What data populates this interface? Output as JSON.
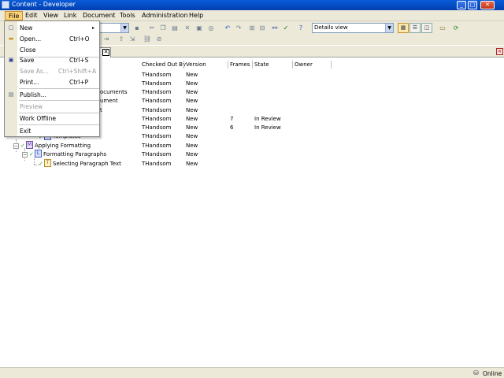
{
  "window": {
    "title": "Content - Developer",
    "buttons": {
      "minimize": "_",
      "maximize": "□",
      "close": "✕"
    }
  },
  "menubar": {
    "items": [
      "File",
      "Edit",
      "View",
      "Link",
      "Document",
      "Tools",
      "Administration",
      "Help"
    ]
  },
  "toolbar": {
    "view_combo_value": "Details view"
  },
  "doc_tab": {
    "label": "g"
  },
  "columns": {
    "checked_out_by": "Checked Out By",
    "version": "Version",
    "frames": "Frames",
    "state": "State",
    "owner": "Owner"
  },
  "rows": [
    {
      "name": "",
      "checked_out_by": "THandsom",
      "version": "New",
      "frames": "",
      "state": ""
    },
    {
      "name": "",
      "checked_out_by": "THandsom",
      "version": "New",
      "frames": "",
      "state": ""
    },
    {
      "name": "ocuments",
      "checked_out_by": "THandsom",
      "version": "New",
      "frames": "",
      "state": ""
    },
    {
      "name": "ument",
      "checked_out_by": "THandsom",
      "version": "New",
      "frames": "",
      "state": ""
    },
    {
      "name": "t",
      "checked_out_by": "THandsom",
      "version": "New",
      "frames": "",
      "state": ""
    },
    {
      "name": "",
      "checked_out_by": "THandsom",
      "version": "New",
      "frames": "7",
      "state": "In Review"
    },
    {
      "name": "",
      "checked_out_by": "THandsom",
      "version": "New",
      "frames": "6",
      "state": "In Review"
    },
    {
      "name": "Templates",
      "checked_out_by": "THandsom",
      "version": "New",
      "frames": "",
      "state": ""
    },
    {
      "name": "Applying Formatting",
      "checked_out_by": "THandsom",
      "version": "New",
      "frames": "",
      "state": ""
    },
    {
      "name": "Formatting Paragraphs",
      "checked_out_by": "THandsom",
      "version": "New",
      "frames": "",
      "state": ""
    },
    {
      "name": "Selecting Paragraph Text",
      "checked_out_by": "THandsom",
      "version": "New",
      "frames": "",
      "state": ""
    }
  ],
  "file_menu": {
    "items": [
      {
        "label": "New",
        "shortcut": "",
        "submenu": true,
        "disabled": false
      },
      {
        "label": "Open...",
        "shortcut": "Ctrl+O",
        "disabled": false
      },
      {
        "label": "Close",
        "shortcut": "",
        "disabled": false
      },
      {
        "label": "Save",
        "shortcut": "Ctrl+S",
        "disabled": false
      },
      {
        "label": "Save As...",
        "shortcut": "Ctrl+Shift+A",
        "disabled": true
      },
      {
        "label": "Print...",
        "shortcut": "Ctrl+P",
        "disabled": false
      },
      {
        "label": "Publish...",
        "shortcut": "",
        "disabled": false
      },
      {
        "label": "Preview",
        "shortcut": "",
        "disabled": true
      },
      {
        "label": "Work Offline",
        "shortcut": "",
        "disabled": false
      },
      {
        "label": "Exit",
        "shortcut": "",
        "disabled": false
      }
    ],
    "submenu_arrow": "▸"
  },
  "statusbar": {
    "connection": "Online"
  },
  "icons": {
    "tree_check": "✓",
    "expander_minus": "−"
  },
  "colors": {
    "title_bar": "#0a5bd9",
    "menu_active": "#ffd27a",
    "check": "#1a9a1a"
  }
}
